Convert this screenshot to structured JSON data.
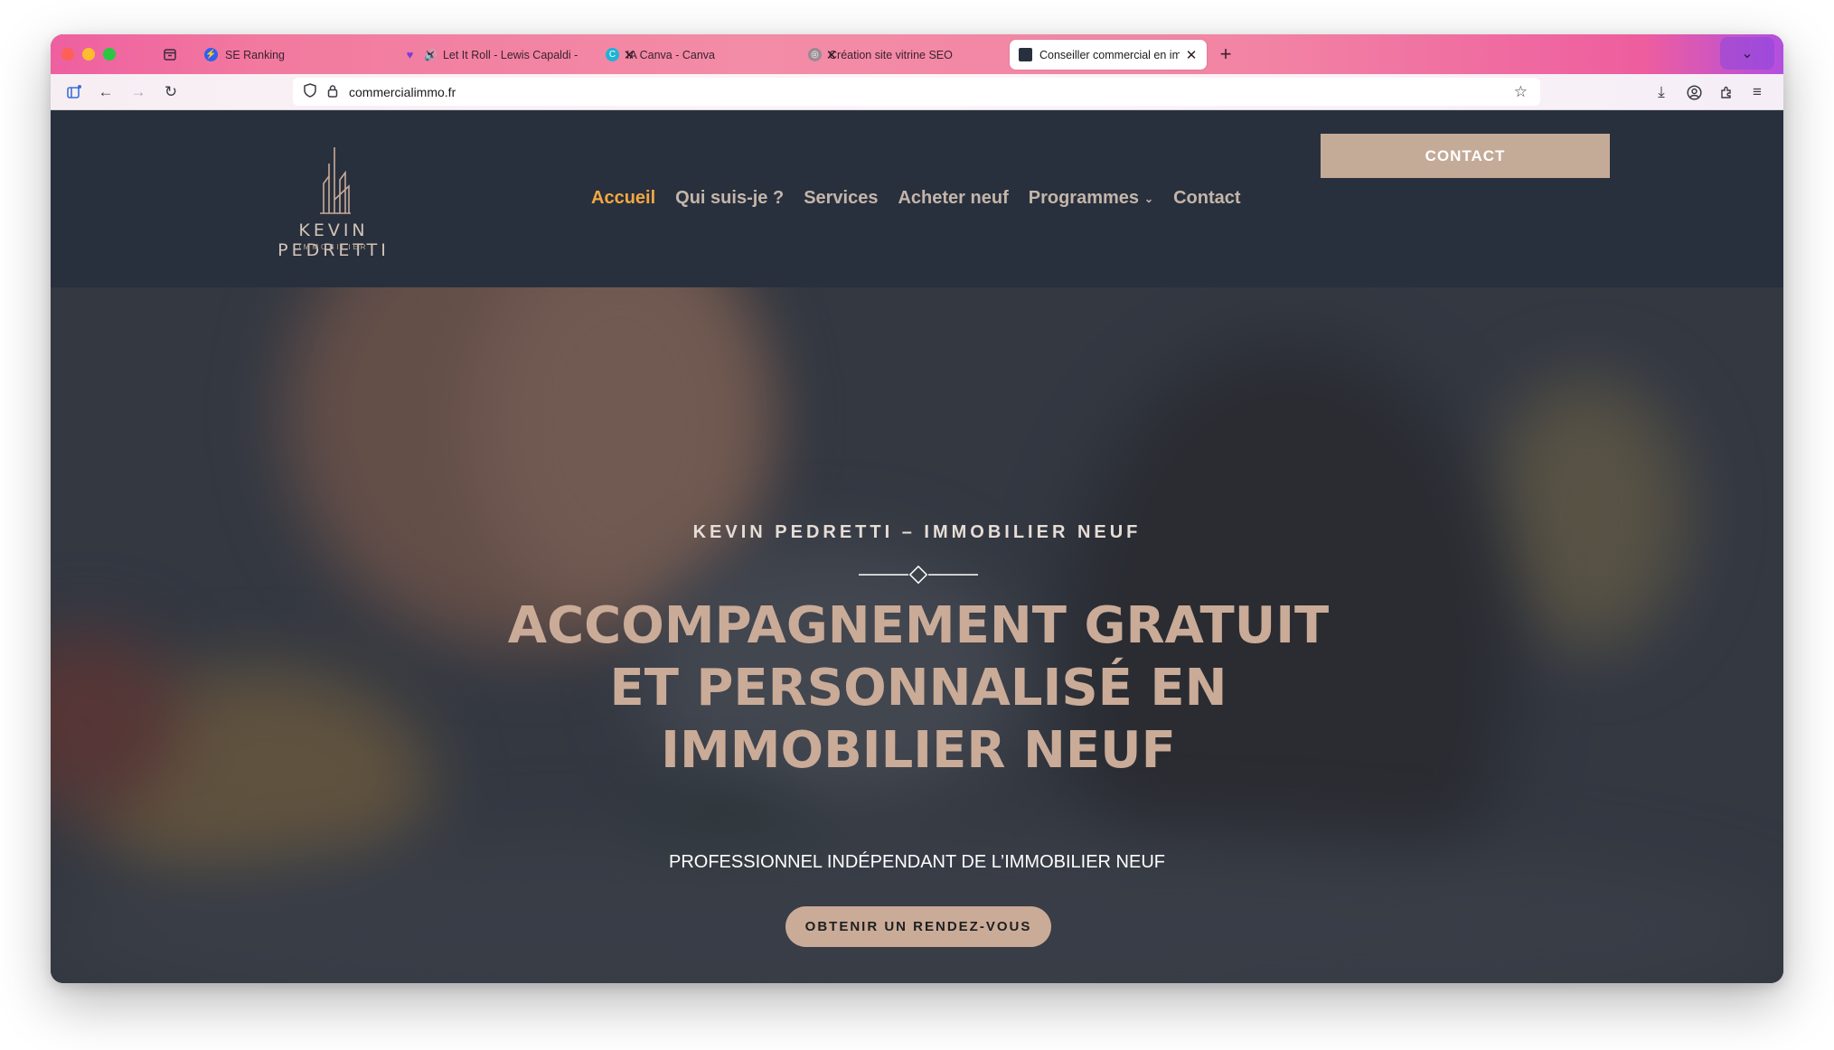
{
  "browser": {
    "tabs": [
      {
        "label": "SE Ranking",
        "favicon": "se-ranking-icon",
        "active": false
      },
      {
        "label": "Let It Roll - Lewis Capaldi -",
        "favicon": "heart-icon",
        "active": false,
        "playing": true
      },
      {
        "label": "IA Canva - Canva",
        "favicon": "canva-icon",
        "active": false
      },
      {
        "label": "Création site vitrine SEO",
        "favicon": "globe-icon",
        "active": false
      },
      {
        "label": "Conseiller commercial en immob",
        "favicon": "site-icon",
        "active": true
      }
    ],
    "url": "commercialimmo.fr"
  },
  "site": {
    "logo": {
      "name": "KEVIN PEDRETTI",
      "sub": "IMMOBILIER"
    },
    "menu": [
      {
        "label": "Accueil",
        "active": true
      },
      {
        "label": "Qui suis-je ?"
      },
      {
        "label": "Services"
      },
      {
        "label": "Acheter neuf"
      },
      {
        "label": "Programmes",
        "has_submenu": true
      },
      {
        "label": "Contact"
      }
    ],
    "contact_button": "CONTACT"
  },
  "hero": {
    "kicker": "KEVIN PEDRETTI – IMMOBILIER NEUF",
    "title_lines": [
      "ACCOMPAGNEMENT GRATUIT",
      "ET PERSONNALISÉ EN",
      "IMMOBILIER NEUF"
    ],
    "subtitle": "PROFESSIONNEL INDÉPENDANT DE L’IMMOBILIER NEUF",
    "cta": "OBTENIR UN RENDEZ-VOUS"
  },
  "colors": {
    "header_bg": "#28303d",
    "accent_gold": "#c4ab98",
    "menu_active": "#f3a842"
  }
}
